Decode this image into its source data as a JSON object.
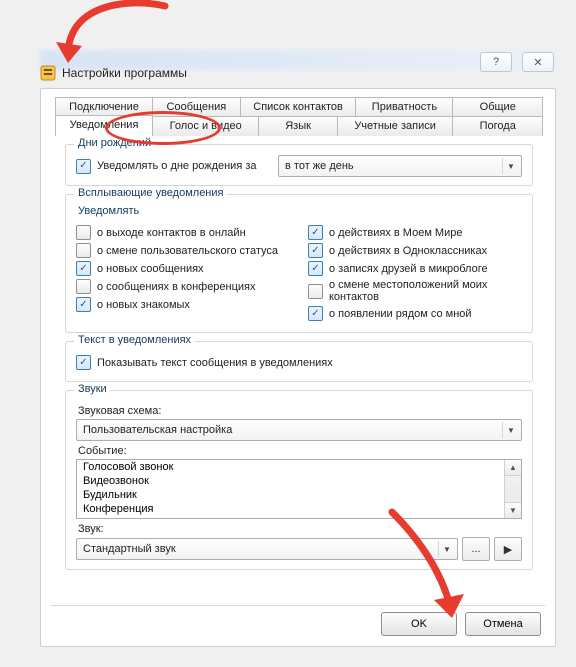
{
  "window": {
    "title": "Настройки программы",
    "help_glyph": "?",
    "close_glyph": "✕"
  },
  "tabs": {
    "row1": [
      "Подключение",
      "Сообщения",
      "Список контактов",
      "Приватность",
      "Общие"
    ],
    "row2": [
      "Уведомления",
      "Голос и видео",
      "Язык",
      "Учетные записи",
      "Погода"
    ],
    "active": "Уведомления"
  },
  "birthdays": {
    "legend": "Дни рождений",
    "notify_label": "Уведомлять о дне рождения за",
    "notify_checked": true,
    "dropdown_value": "в тот же день"
  },
  "popups": {
    "legend": "Всплывающие уведомления",
    "sub_legend": "Уведомлять",
    "left": [
      {
        "label": "о выходе контактов в онлайн",
        "checked": false
      },
      {
        "label": "о смене пользовательского статуса",
        "checked": false
      },
      {
        "label": "о новых сообщениях",
        "checked": true
      },
      {
        "label": "о сообщениях в конференциях",
        "checked": false
      },
      {
        "label": "о новых знакомых",
        "checked": true
      }
    ],
    "right": [
      {
        "label": "о действиях в Моем Мире",
        "checked": true
      },
      {
        "label": "о действиях в Одноклассниках",
        "checked": true
      },
      {
        "label": "о записях друзей в микроблоге",
        "checked": true
      },
      {
        "label": "о смене местоположений моих контактов",
        "checked": false
      },
      {
        "label": "о появлении рядом со мной",
        "checked": true
      }
    ]
  },
  "text_in_notif": {
    "legend": "Текст в уведомлениях",
    "label": "Показывать текст сообщения в уведомлениях",
    "checked": true
  },
  "sounds": {
    "legend": "Звуки",
    "scheme_label": "Звуковая схема:",
    "scheme_value": "Пользовательская настройка",
    "event_label": "Событие:",
    "events": [
      "Голосовой звонок",
      "Видеозвонок",
      "Будильник",
      "Конференция"
    ],
    "sound_label": "Звук:",
    "sound_value": "Стандартный звук",
    "browse_label": "...",
    "play_label": "▶"
  },
  "buttons": {
    "ok": "OK",
    "cancel": "Отмена"
  }
}
